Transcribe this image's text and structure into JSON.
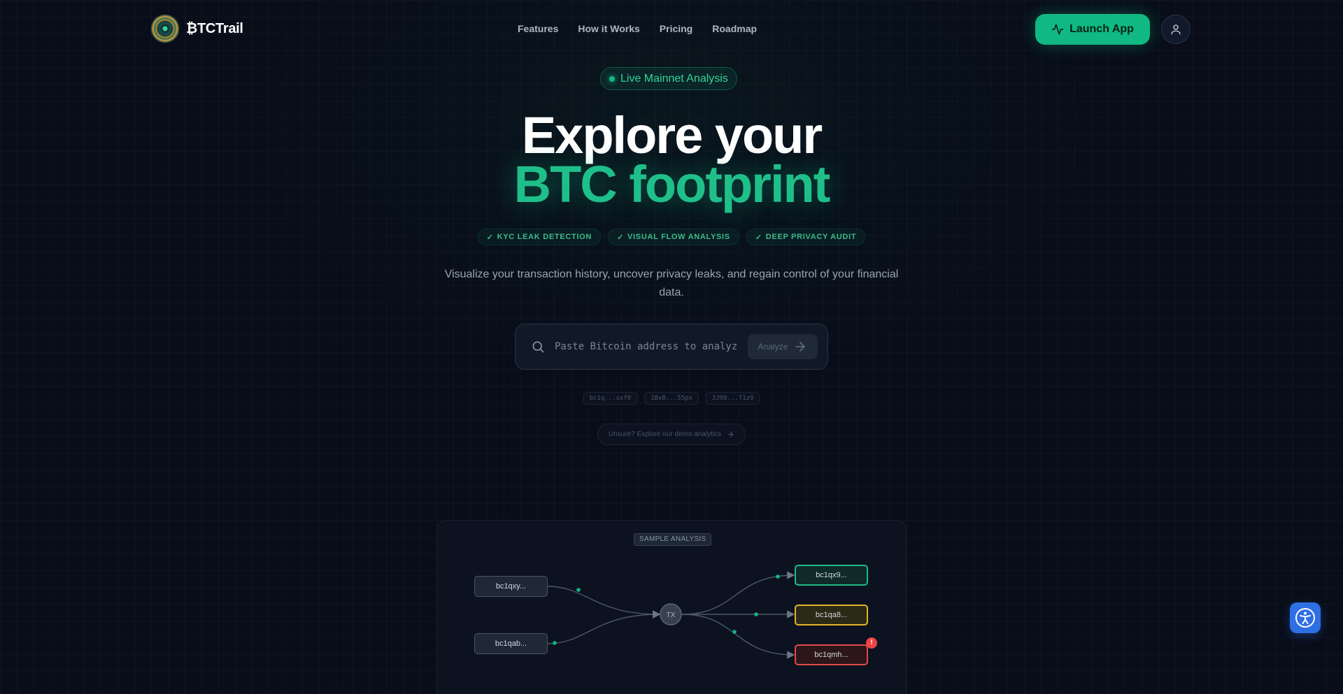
{
  "nav": {
    "brand": "₿TCTrail",
    "links": [
      "Features",
      "How it Works",
      "Pricing",
      "Roadmap"
    ],
    "launch_label": "Launch App"
  },
  "hero": {
    "badge": "Live Mainnet Analysis",
    "title_line1": "Explore your",
    "title_line2": "BTC footprint",
    "features": [
      "KYC LEAK DETECTION",
      "VISUAL FLOW ANALYSIS",
      "DEEP PRIVACY AUDIT"
    ],
    "subtitle": "Visualize your transaction history, uncover privacy leaks, and regain control of your financial data."
  },
  "search": {
    "placeholder": "Paste Bitcoin address to analyze",
    "value": "",
    "button_label": "Analyze"
  },
  "samples": [
    "bc1q...sxf0",
    "1BvB...55px",
    "3J98...T1z9"
  ],
  "demo_link": "Unsure? Explore our demo analytics",
  "sample_panel": {
    "label": "SAMPLE ANALYSIS",
    "inputs": [
      "bc1qxy...",
      "bc1qab..."
    ],
    "tx_label": "TX",
    "outputs": [
      {
        "label": "bc1qx9...",
        "status": "clean",
        "color": "#1fb98a"
      },
      {
        "label": "bc1qa8...",
        "status": "warning",
        "color": "#e2b42a"
      },
      {
        "label": "bc1qmh...",
        "status": "risk",
        "color": "#e04848"
      }
    ],
    "alert_mark": "!"
  },
  "icons": {
    "brand": "btctrail-logo-icon",
    "launch": "activity-icon",
    "user": "user-icon",
    "search": "search-icon",
    "analyze": "arrow-right-icon",
    "feature": "check-icon",
    "accessibility": "accessibility-icon"
  },
  "colors": {
    "accent": "#10b981",
    "background": "#080d19",
    "warning": "#e2b42a",
    "danger": "#e04848"
  }
}
